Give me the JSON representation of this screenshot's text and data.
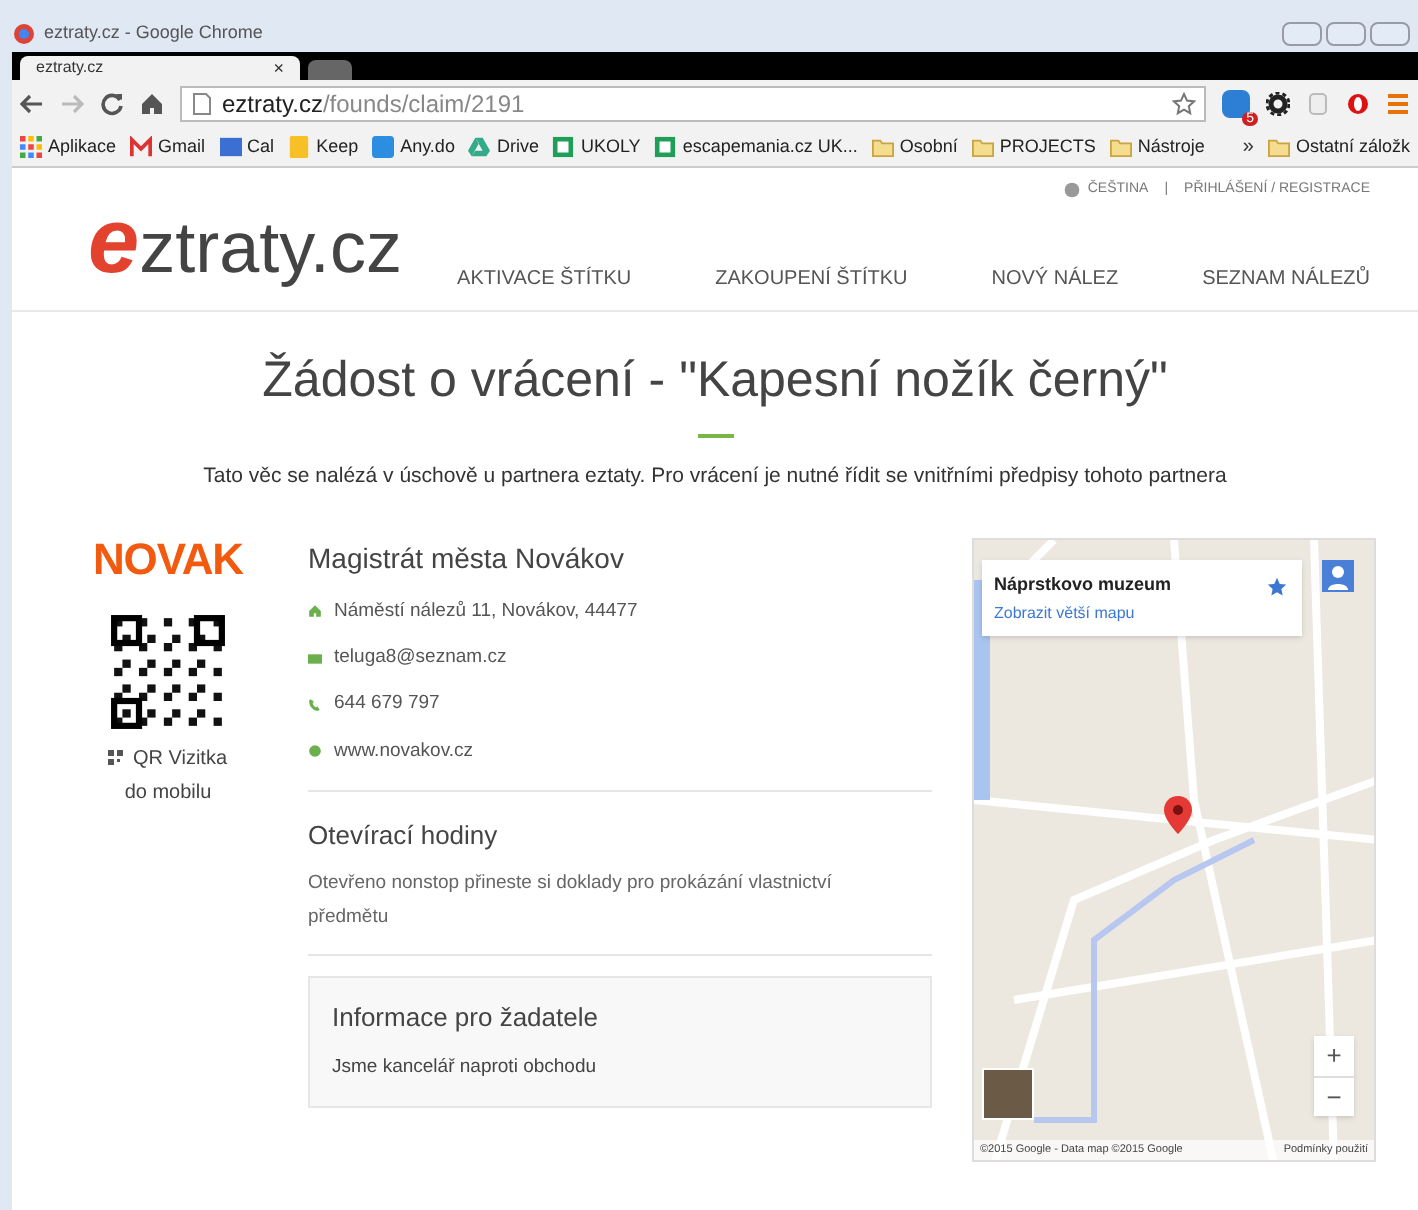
{
  "window": {
    "title": "eztraty.cz - Google Chrome"
  },
  "tabs": [
    {
      "label": "eztraty.cz",
      "selected": true,
      "close": "×"
    }
  ],
  "address_bar": {
    "host": "eztraty.cz",
    "path": "/founds/claim/2191"
  },
  "extension_badge": "5",
  "bookmarks": [
    {
      "label": "Aplikace",
      "kind": "apps"
    },
    {
      "label": "Gmail",
      "kind": "gmail"
    },
    {
      "label": "Cal",
      "kind": "cal"
    },
    {
      "label": "Keep",
      "kind": "keep"
    },
    {
      "label": "Any.do",
      "kind": "anydo"
    },
    {
      "label": "Drive",
      "kind": "drive"
    },
    {
      "label": "UKOLY",
      "kind": "sheet"
    },
    {
      "label": "escapemania.cz UK...",
      "kind": "sheet"
    },
    {
      "label": "Osobní",
      "kind": "folder"
    },
    {
      "label": "PROJECTS",
      "kind": "folder"
    },
    {
      "label": "Nástroje",
      "kind": "folder"
    }
  ],
  "bookmarks_more": "»",
  "other_bookmarks": "Ostatní záložk",
  "top_links": {
    "language": "ČEŠTINA",
    "separator": "|",
    "login": "PŘIHLÁŠENÍ / REGISTRACE"
  },
  "logo": {
    "first": "e",
    "rest": "ztraty.cz"
  },
  "nav": [
    "AKTIVACE ŠTÍTKU",
    "ZAKOUPENÍ ŠTÍTKU",
    "NOVÝ NÁLEZ",
    "SEZNAM NÁLEZŮ"
  ],
  "title": "Žádost o vrácení - \"Kapesní nožík černý\"",
  "intro": "Tato věc se nalézá v úschově u partnera eztaty. Pro vrácení je nutné řídit se vnitřními předpisy tohoto partnera",
  "partner": {
    "logo": "NOVAK",
    "qr_caption": [
      "QR Vizitka",
      "do mobilu"
    ],
    "name": "Magistrát města Novákov",
    "contacts": [
      {
        "kind": "address",
        "text": "Náměstí nálezů 11, Novákov, 44477"
      },
      {
        "kind": "email",
        "text": "teluga8@seznam.cz"
      },
      {
        "kind": "phone",
        "text": "644 679 797"
      },
      {
        "kind": "web",
        "text": "www.novakov.cz"
      }
    ],
    "hours_title": "Otevírací hodiny",
    "hours_text": "Otevřeno nonstop přineste si doklady pro prokázání vlastnictví předmětu",
    "info_title": "Informace pro žadatele",
    "info_text": "Jsme kancelář naproti obchodu"
  },
  "map": {
    "place": "Náprstkovo muzeum",
    "larger_map": "Zobrazit větší mapu",
    "zoom_in": "+",
    "zoom_out": "−",
    "attribution": "©2015 Google - Data map ©2015 Google",
    "terms": "Podmínky použití"
  }
}
